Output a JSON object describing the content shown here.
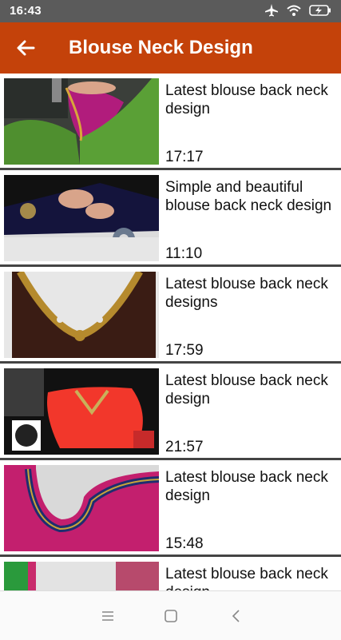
{
  "status": {
    "time": "16:43",
    "icons": [
      "airplane-icon",
      "wifi-icon",
      "battery-charging-icon"
    ]
  },
  "appbar": {
    "title": "Blouse Neck Design",
    "back_icon": "arrow-back-icon"
  },
  "videos": [
    {
      "title": "Latest blouse back neck design",
      "duration": "17:17"
    },
    {
      "title": "Simple and beautiful blouse back neck design",
      "duration": "11:10"
    },
    {
      "title": "Latest blouse back neck designs",
      "duration": "17:59"
    },
    {
      "title": "Latest blouse back neck design",
      "duration": "21:57"
    },
    {
      "title": "Latest blouse back neck design",
      "duration": "15:48"
    },
    {
      "title": "Latest blouse back neck design",
      "duration": ""
    }
  ],
  "navbar": {
    "icons": [
      "menu-icon",
      "home-icon",
      "back-triangle-icon"
    ]
  },
  "colors": {
    "appbar": "#c4420a",
    "statusbar": "#5b5b5b"
  }
}
